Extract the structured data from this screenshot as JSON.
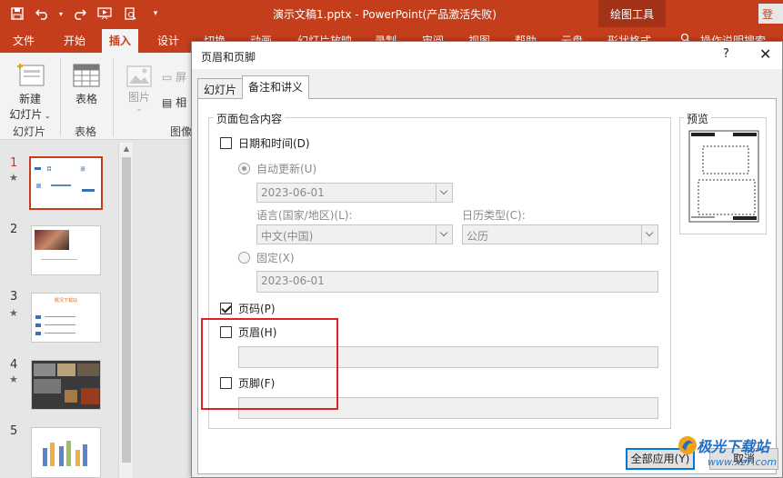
{
  "titlebar": {
    "doc_title": "演示文稿1.pptx  -  PowerPoint(产品激活失败)",
    "context_tab": "绘图工具",
    "login": "登"
  },
  "ribbon_tabs": {
    "file": "文件",
    "home": "开始",
    "insert": "插入",
    "design": "设计",
    "transitions": "切换",
    "animations": "动画",
    "slideshow": "幻灯片放映",
    "record": "录制",
    "review": "审阅",
    "view": "视图",
    "help": "帮助",
    "cloud": "云盘",
    "format": "形状格式",
    "tellme": "操作说明搜索"
  },
  "ribbon": {
    "new_slide_line1": "新建",
    "new_slide_line2": "幻灯片",
    "group_slides": "幻灯片",
    "table": "表格",
    "group_table": "表格",
    "picture": "图片",
    "screenshot": "屏",
    "album": "相",
    "group_images": "图像"
  },
  "thumbnails": {
    "n1": "1",
    "n2": "2",
    "n3": "3",
    "n4": "4",
    "n5": "5",
    "star": "★",
    "slide1_title_left": "目",
    "slide1_title_right": "录",
    "slide3_title": "概况下载站"
  },
  "dialog": {
    "title": "页眉和页脚",
    "help": "?",
    "close": "✕",
    "tab_slide": "幻灯片",
    "tab_notes": "备注和讲义",
    "group_label": "页面包含内容",
    "preview_label": "预览",
    "date_time": "日期和时间(D)",
    "auto_update": "自动更新(U)",
    "auto_date_value": "2023-06-01",
    "language_label": "语言(国家/地区)(L):",
    "language_value": "中文(中国)",
    "calendar_label": "日历类型(C):",
    "calendar_value": "公历",
    "fixed": "固定(X)",
    "fixed_value": "2023-06-01",
    "page_number": "页码(P)",
    "header": "页眉(H)",
    "footer": "页脚(F)",
    "apply_all": "全部应用(Y)",
    "cancel": "取消",
    "date_checked": false,
    "page_number_checked": true,
    "header_checked": false,
    "footer_checked": false,
    "header_value": "",
    "footer_value": ""
  },
  "watermark": {
    "brand": "极光下载站",
    "url": "www.xz7.com"
  },
  "colors": {
    "accent": "#c43e1c",
    "highlight": "#e12222",
    "default_button": "#0078d7"
  }
}
